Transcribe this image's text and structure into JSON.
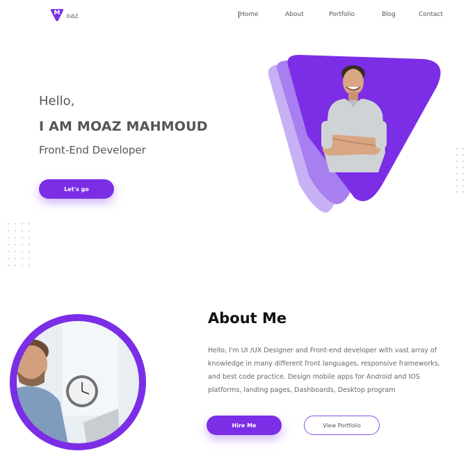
{
  "brand": {
    "logo_letter": "M",
    "logo_text": "oaz"
  },
  "nav": {
    "items": [
      {
        "label": "Home",
        "active": true
      },
      {
        "label": "About"
      },
      {
        "label": "Portfolio"
      },
      {
        "label": "Blog"
      },
      {
        "label": "Contact"
      }
    ]
  },
  "hero": {
    "greeting": "Hello,",
    "name": "I AM MOAZ MAHMOUD",
    "role": "Front-End Developer",
    "cta_label": "Let's go"
  },
  "about": {
    "title": "About Me",
    "text": "Hello, I'm UI /UX Designer and  Front-end developer with vast array of knowledge in many different front languages, responsive frameworks, and best code practice. Design mobile apps for Android and IOS platforms, landing pages, Dashboards, Desktop program",
    "hire_label": "Hire Me",
    "portfolio_label": "View Portfolio"
  },
  "colors": {
    "accent": "#7b2ee6",
    "accent_light": "#a77ff0",
    "accent_lighter": "#c8b0f5",
    "text": "#555555",
    "dots": "#d8d8d8"
  },
  "icons": {
    "logo": "triangle-logo-icon",
    "person": "developer-portrait",
    "about_photo": "man-at-laptop-photo"
  }
}
